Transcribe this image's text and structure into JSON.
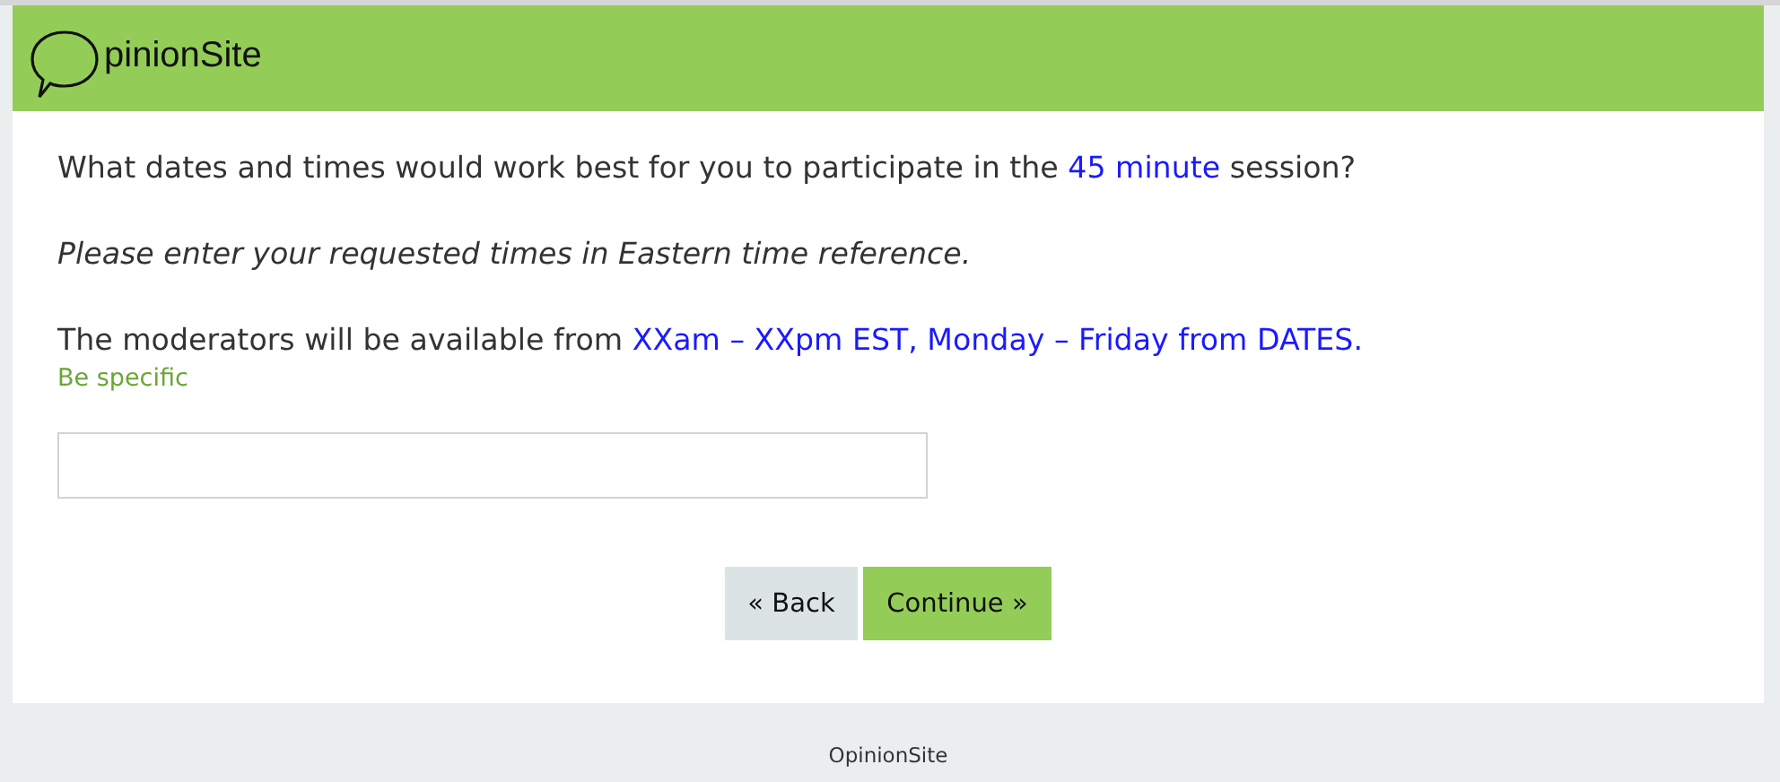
{
  "header": {
    "logo_text": "pinionSite"
  },
  "question": {
    "parts": [
      {
        "text": "What dates and times would work best for you to participate in the ",
        "highlight": false
      },
      {
        "text": "45 minute",
        "highlight": true
      },
      {
        "text": " session?",
        "highlight": false
      }
    ]
  },
  "instruction": "Please enter your requested times in Eastern time reference.",
  "availability": {
    "parts": [
      {
        "text": "The moderators will be available from ",
        "highlight": false
      },
      {
        "text": "XXam – XXpm EST, Monday – Friday from DATES.",
        "highlight": true
      }
    ]
  },
  "hint": "Be specific",
  "buttons": [
    {
      "label": "« Back",
      "kind": "back"
    },
    {
      "label": "Continue »",
      "kind": "next"
    }
  ],
  "footer": "OpinionSite"
}
